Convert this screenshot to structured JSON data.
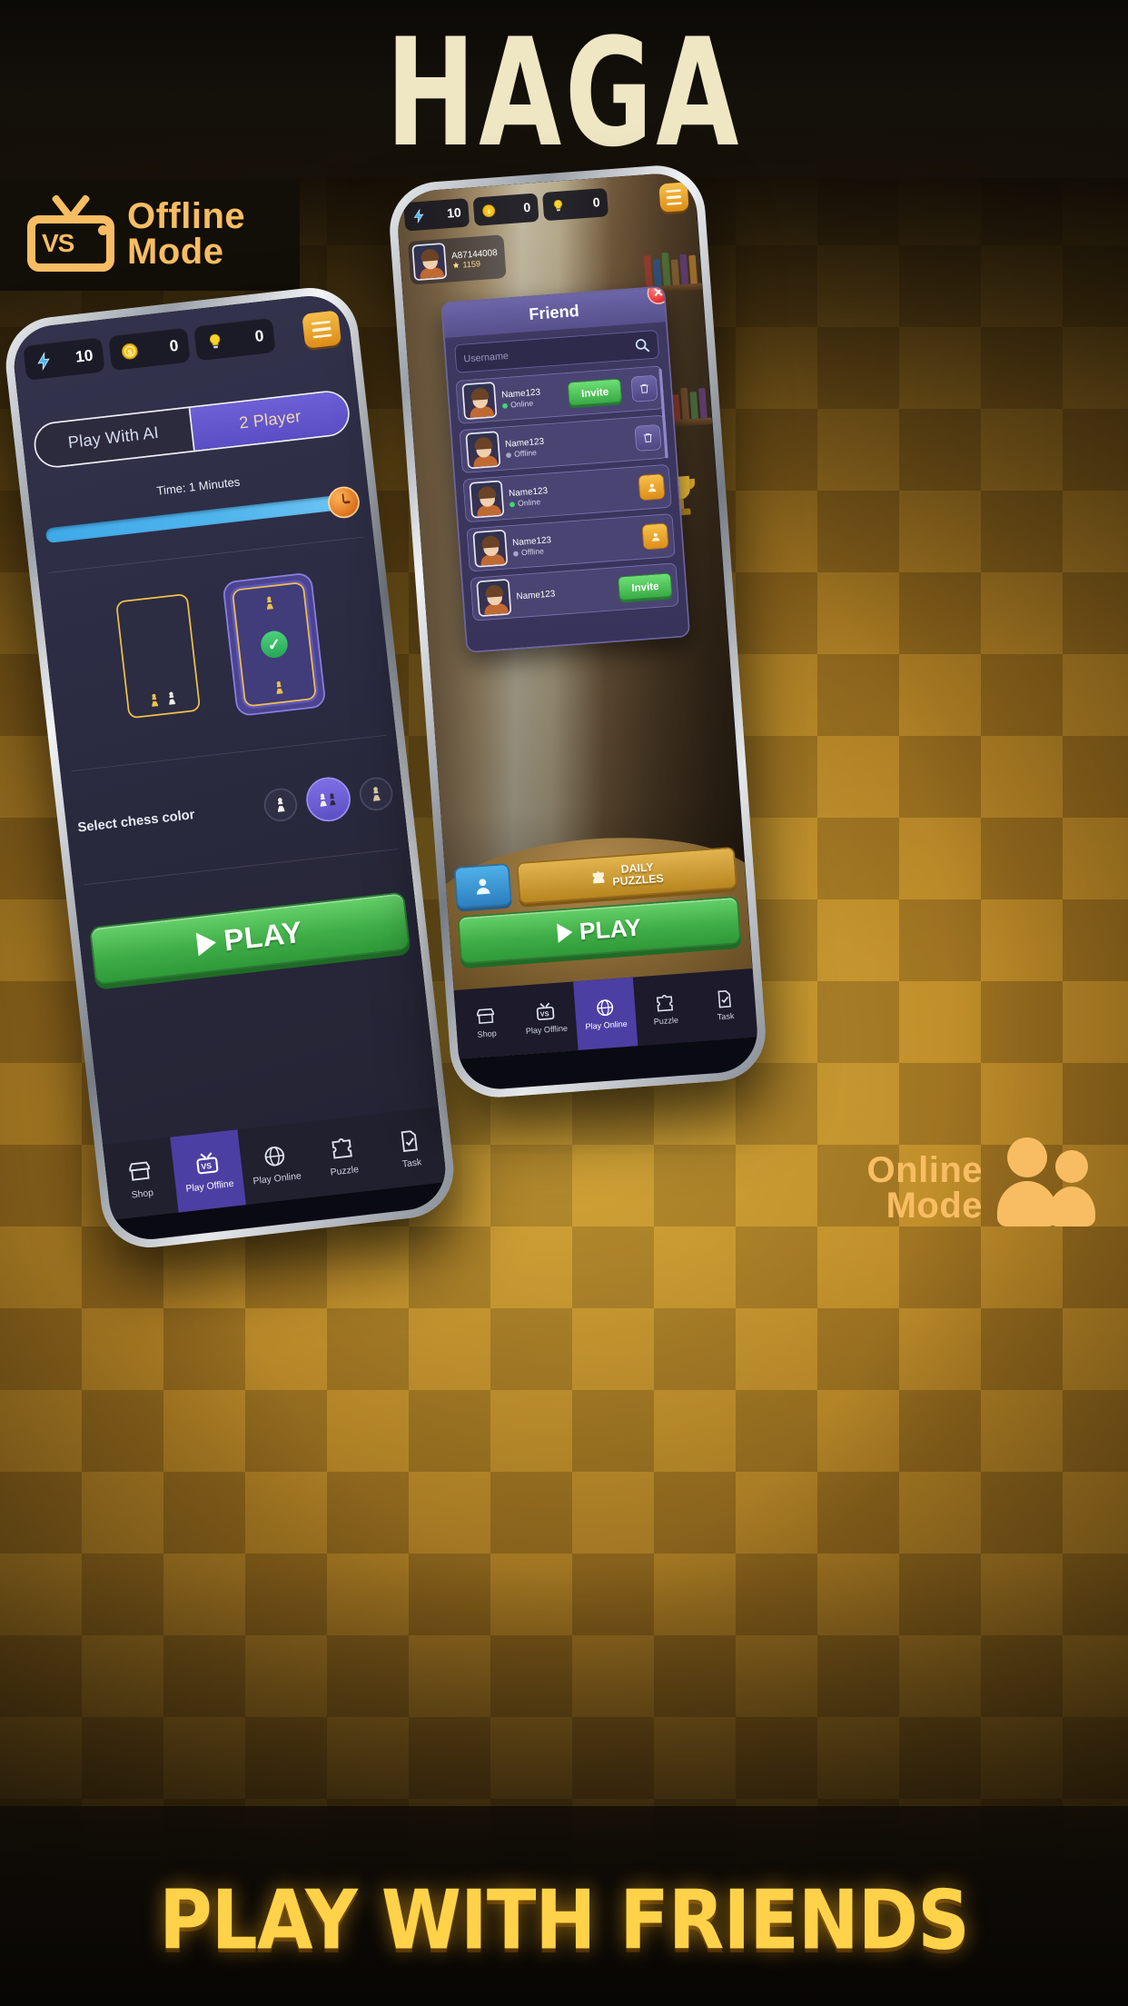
{
  "app_title": "HAGA",
  "headline": "PLAY WITH FRIENDS",
  "badges": {
    "offline": {
      "line1": "Offline",
      "line2": "Mode",
      "icon_label": "VS",
      "icon": "tv-vs-icon"
    },
    "online": {
      "line1": "Online",
      "line2": "Mode",
      "icon": "people-icon"
    }
  },
  "colors": {
    "accent_gold": "#f8bd63",
    "title_cream": "#efe6c4",
    "headline_yellow": "#ffd24a",
    "play_green": "#3fae47",
    "purple_select": "#5b4ec4",
    "online_dot": "#3ddc6b",
    "offline_dot": "#a9a4c6"
  },
  "offline_phone": {
    "stats": [
      {
        "icon": "lightning-icon",
        "value": "10"
      },
      {
        "icon": "coin-icon",
        "value": "0"
      },
      {
        "icon": "bulb-icon",
        "value": "0"
      }
    ],
    "menu_icon": "hamburger-menu-icon",
    "mode_tabs": [
      {
        "label": "Play With AI",
        "selected": false
      },
      {
        "label": "2 Player",
        "selected": true
      }
    ],
    "time_label": "Time: 1 Minutes",
    "slider": {
      "value_percent": 88,
      "knob_icon": "clock-icon"
    },
    "devices": [
      {
        "name": "single-device-option",
        "selected": false
      },
      {
        "name": "two-device-option",
        "selected": true,
        "badge": "check-icon"
      }
    ],
    "chess_color": {
      "label": "Select chess color",
      "options": [
        {
          "name": "white-pawn",
          "selected": false
        },
        {
          "name": "random-pawns",
          "selected": true
        },
        {
          "name": "black-pawn",
          "selected": false
        }
      ]
    },
    "play_label": "PLAY",
    "nav": [
      {
        "label": "Shop",
        "icon": "shop-icon",
        "active": false
      },
      {
        "label": "Play Offline",
        "icon": "tv-vs-icon",
        "active": true
      },
      {
        "label": "Play Online",
        "icon": "globe-icon",
        "active": false
      },
      {
        "label": "Puzzle",
        "icon": "puzzle-icon",
        "active": false
      },
      {
        "label": "Task",
        "icon": "task-icon",
        "active": false
      }
    ]
  },
  "online_phone": {
    "stats": [
      {
        "icon": "lightning-icon",
        "value": "10"
      },
      {
        "icon": "coin-icon",
        "value": "0"
      },
      {
        "icon": "bulb-icon",
        "value": "0"
      }
    ],
    "menu_icon": "hamburger-menu-icon",
    "player": {
      "name": "A87144008",
      "rating": "1159",
      "rating_icon": "rank-icon"
    },
    "dialog": {
      "title": "Friend",
      "close_icon": "close-icon",
      "search_placeholder": "Username",
      "search_icon": "search-icon",
      "friends": [
        {
          "name": "Name123",
          "status": "Online",
          "online": true,
          "action": "Invite",
          "buttons": [
            "invite-button",
            "delete-button"
          ]
        },
        {
          "name": "Name123",
          "status": "Offline",
          "online": false,
          "action": "",
          "buttons": [
            "delete-button"
          ]
        },
        {
          "name": "Name123",
          "status": "Online",
          "online": true,
          "action": "",
          "buttons": [
            "profile-button"
          ]
        },
        {
          "name": "Name123",
          "status": "Offline",
          "online": false,
          "action": "",
          "buttons": [
            "profile-button"
          ]
        },
        {
          "name": "Name123",
          "status": "",
          "online": true,
          "action": "Invite",
          "buttons": [
            "invite-button"
          ]
        }
      ]
    },
    "actions": {
      "friends_icon": "person-icon",
      "daily_puzzles_line1": "DAILY",
      "daily_puzzles_line2": "PUZZLES",
      "daily_puzzles_icon": "puzzle-icon",
      "play_label": "PLAY"
    },
    "nav": [
      {
        "label": "Shop",
        "icon": "shop-icon",
        "active": false
      },
      {
        "label": "Play Offline",
        "icon": "tv-vs-icon",
        "active": false
      },
      {
        "label": "Play Online",
        "icon": "globe-icon",
        "active": true
      },
      {
        "label": "Puzzle",
        "icon": "puzzle-icon",
        "active": false
      },
      {
        "label": "Task",
        "icon": "task-icon",
        "active": false
      }
    ]
  }
}
